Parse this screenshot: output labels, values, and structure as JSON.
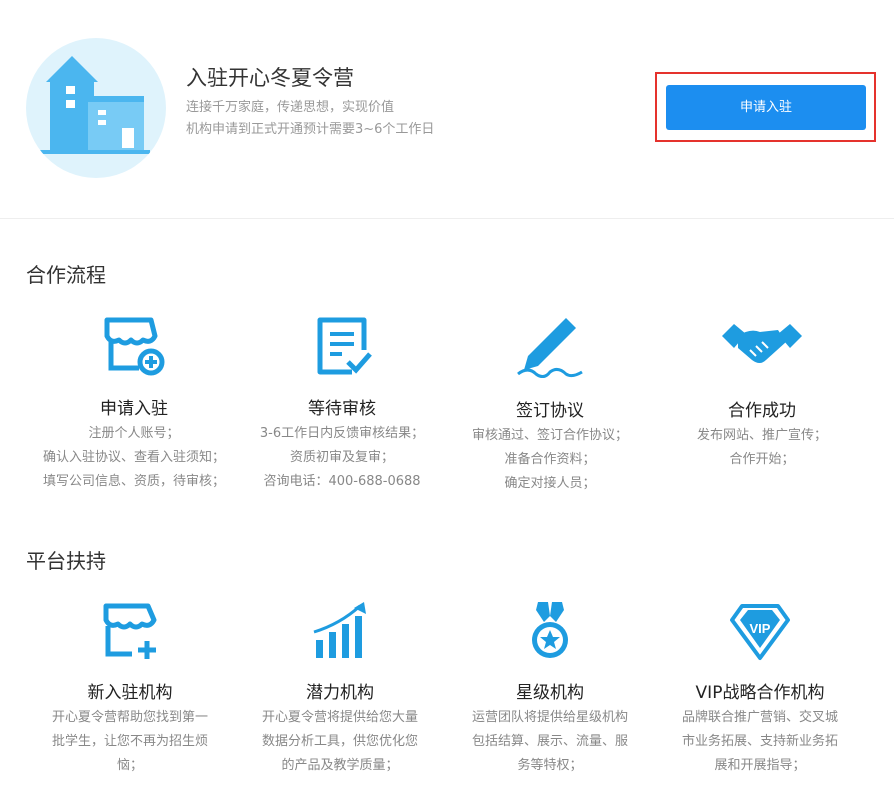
{
  "header": {
    "title": "入驻开心冬夏令营",
    "subtitle": "连接千万家庭，传递思想，实现价值",
    "note": "机构申请到正式开通预计需要3~6个工作日",
    "apply_label": "申请入驻"
  },
  "process": {
    "title": "合作流程",
    "steps": [
      {
        "icon": "shop-plus-icon",
        "title": "申请入驻",
        "lines": [
          "注册个人账号；",
          "确认入驻协议、查看入驻须知；",
          "填写公司信息、资质，待审核；"
        ]
      },
      {
        "icon": "document-check-icon",
        "title": "等待审核",
        "lines": [
          "3-6工作日内反馈审核结果；",
          "资质初审及复审；",
          "咨询电话：400-688-0688"
        ]
      },
      {
        "icon": "pen-signature-icon",
        "title": "签订协议",
        "lines": [
          "审核通过、签订合作协议；",
          "准备合作资料；",
          "确定对接人员；"
        ]
      },
      {
        "icon": "handshake-icon",
        "title": "合作成功",
        "lines": [
          "发布网站、推广宣传；",
          "合作开始；"
        ]
      }
    ]
  },
  "support": {
    "title": "平台扶持",
    "items": [
      {
        "icon": "store-plus-icon",
        "title": "新入驻机构",
        "lines": [
          "开心夏令营帮助您找到第一",
          "批学生，让您不再为招生烦",
          "恼；"
        ]
      },
      {
        "icon": "growth-chart-icon",
        "title": "潜力机构",
        "lines": [
          "开心夏令营将提供给您大量",
          "数据分析工具，供您优化您",
          "的产品及教学质量；"
        ]
      },
      {
        "icon": "star-medal-icon",
        "title": "星级机构",
        "lines": [
          "运营团队将提供给星级机构",
          "包括结算、展示、流量、服",
          "务等特权；"
        ]
      },
      {
        "icon": "vip-diamond-icon",
        "title": "VIP战略合作机构",
        "lines": [
          "品牌联合推广营销、交叉城",
          "市业务拓展、支持新业务拓",
          "展和开展指导；"
        ]
      }
    ]
  },
  "colors": {
    "accent": "#1c8ef0",
    "icon_blue": "#1e9ce0",
    "highlight_border": "#e5322d",
    "logo_bg": "#dff3fc"
  }
}
